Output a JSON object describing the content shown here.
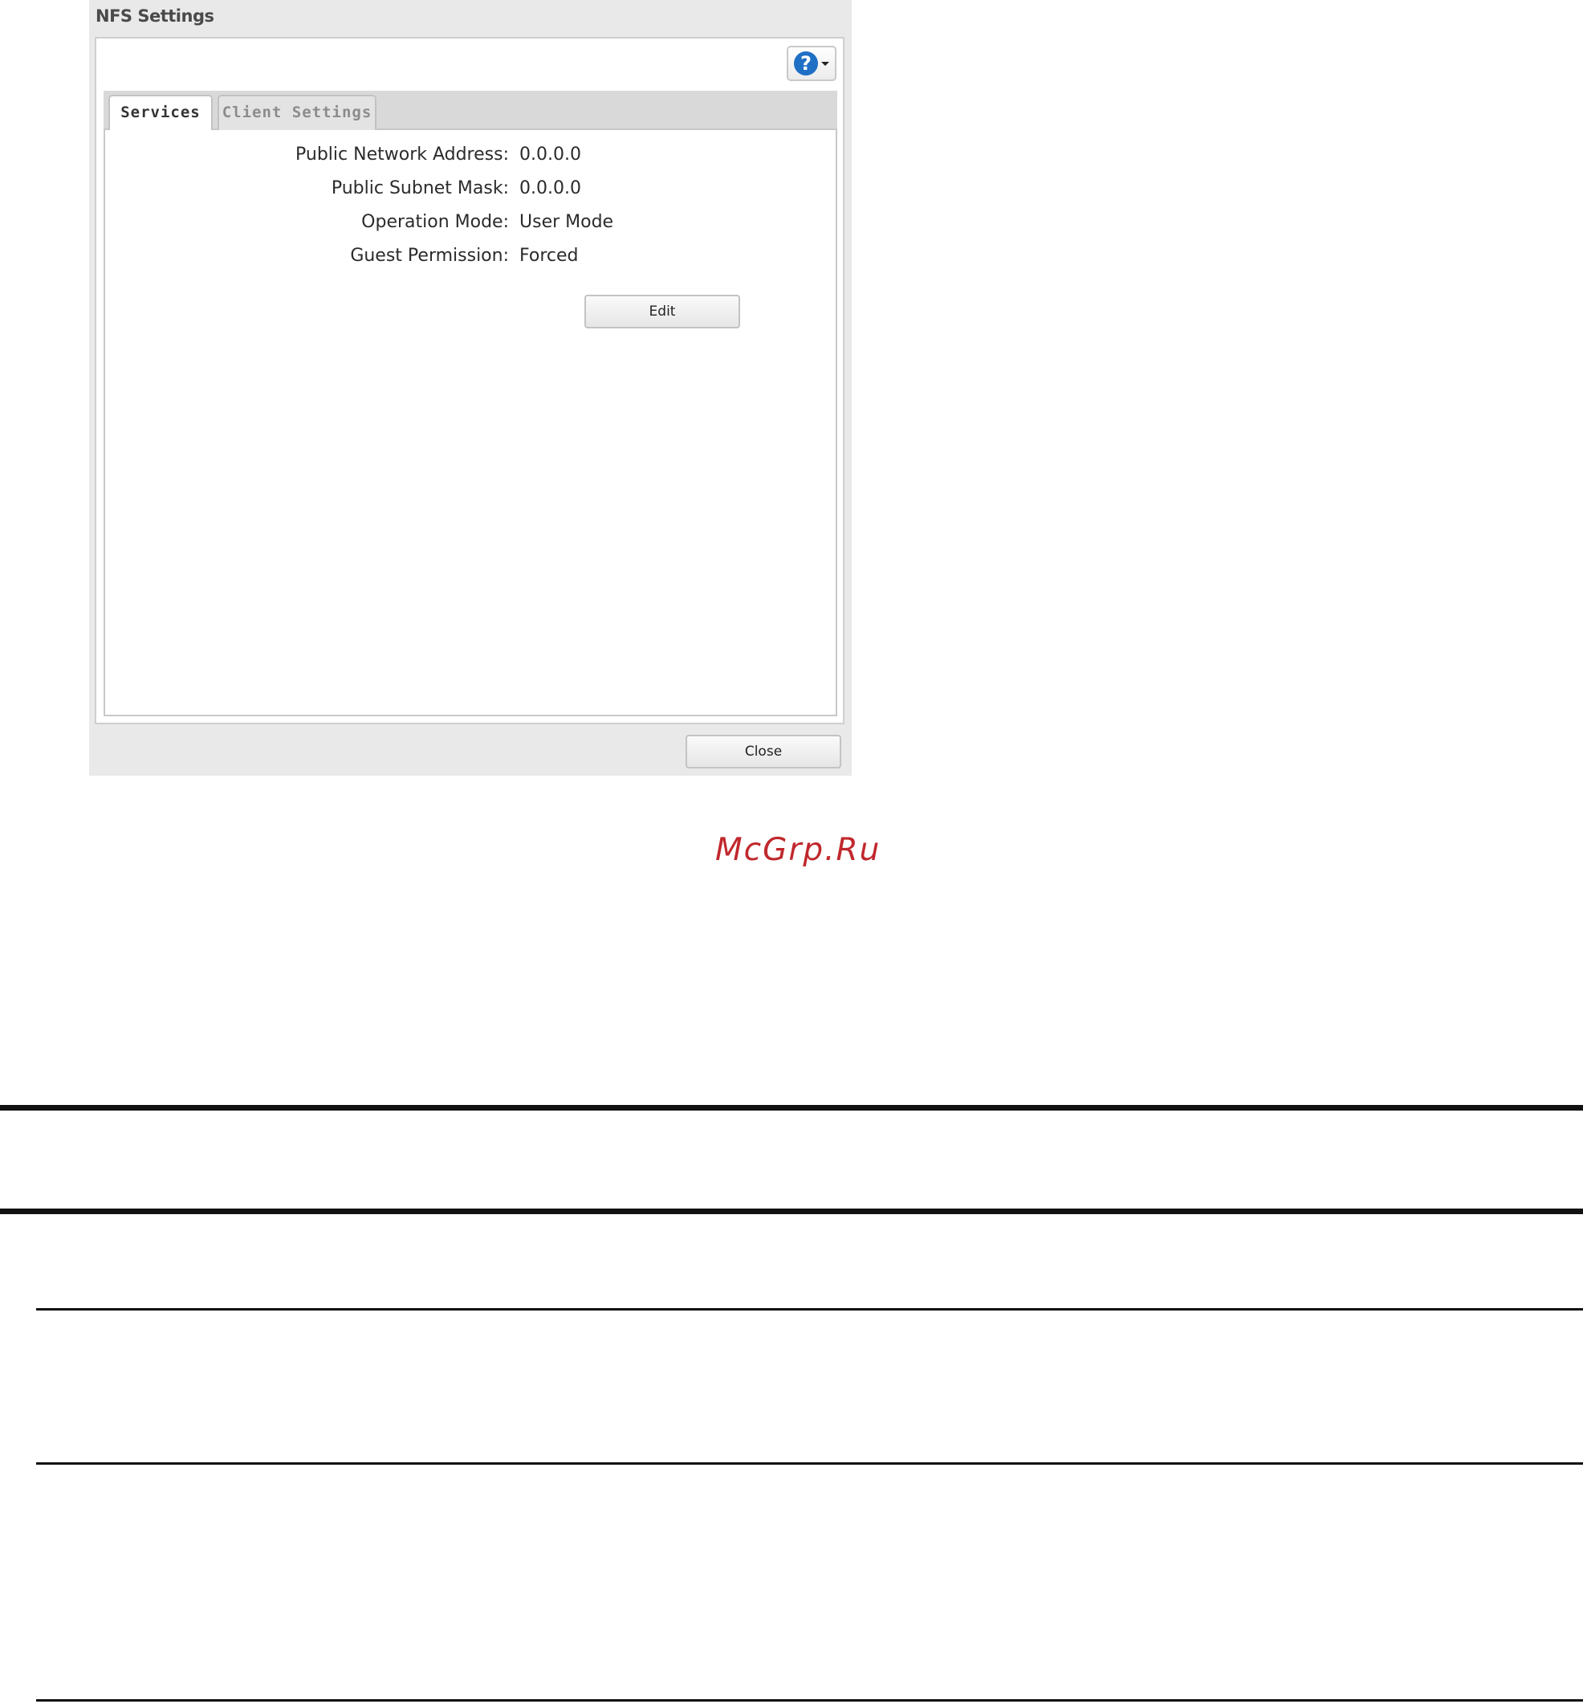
{
  "dialog": {
    "title": "NFS Settings",
    "help_icon_glyph": "?",
    "tabs": [
      {
        "label": "Services",
        "active": true
      },
      {
        "label": "Client Settings",
        "active": false
      }
    ],
    "fields": [
      {
        "label": "Public Network Address:",
        "value": "0.0.0.0"
      },
      {
        "label": "Public Subnet Mask:",
        "value": "0.0.0.0"
      },
      {
        "label": "Operation Mode:",
        "value": "User Mode"
      },
      {
        "label": "Guest Permission:",
        "value": "Forced"
      }
    ],
    "edit_label": "Edit",
    "close_label": "Close"
  },
  "watermark": "McGrp.Ru",
  "colors": {
    "help_icon": "#1f6fc5",
    "watermark": "#c0282d",
    "dialog_bg": "#e9e9e9"
  }
}
